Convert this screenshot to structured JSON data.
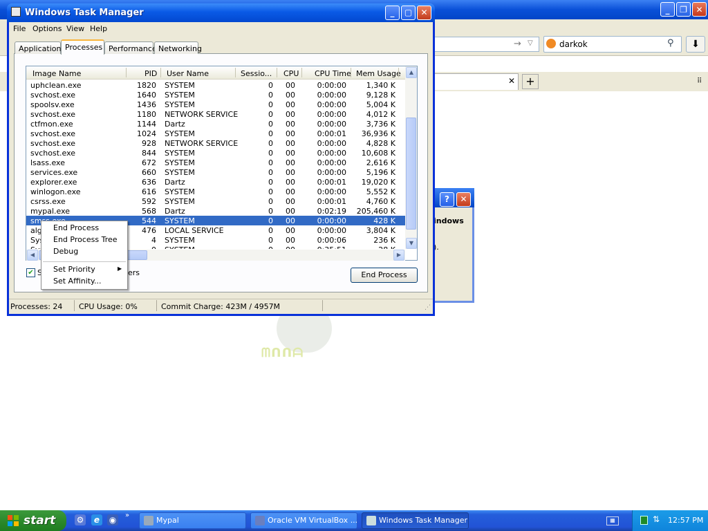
{
  "browser": {
    "search_text": "darkok",
    "dialog_text": "indows",
    "dialog_text2": ")."
  },
  "window": {
    "title": "Windows Task Manager"
  },
  "menu": [
    "File",
    "Options",
    "View",
    "Help"
  ],
  "tabs": [
    "Applications",
    "Processes",
    "Performance",
    "Networking"
  ],
  "columns": [
    "Image Name",
    "PID",
    "User Name",
    "Sessio...",
    "CPU",
    "CPU Time",
    "Mem Usage"
  ],
  "processes": [
    {
      "name": "uphclean.exe",
      "pid": "1820",
      "user": "SYSTEM",
      "session": "0",
      "cpu": "00",
      "time": "0:00:00",
      "mem": "1,340 K"
    },
    {
      "name": "svchost.exe",
      "pid": "1640",
      "user": "SYSTEM",
      "session": "0",
      "cpu": "00",
      "time": "0:00:00",
      "mem": "9,128 K"
    },
    {
      "name": "spoolsv.exe",
      "pid": "1436",
      "user": "SYSTEM",
      "session": "0",
      "cpu": "00",
      "time": "0:00:00",
      "mem": "5,004 K"
    },
    {
      "name": "svchost.exe",
      "pid": "1180",
      "user": "NETWORK SERVICE",
      "session": "0",
      "cpu": "00",
      "time": "0:00:00",
      "mem": "4,012 K"
    },
    {
      "name": "ctfmon.exe",
      "pid": "1144",
      "user": "Dartz",
      "session": "0",
      "cpu": "00",
      "time": "0:00:00",
      "mem": "3,736 K"
    },
    {
      "name": "svchost.exe",
      "pid": "1024",
      "user": "SYSTEM",
      "session": "0",
      "cpu": "00",
      "time": "0:00:01",
      "mem": "36,936 K"
    },
    {
      "name": "svchost.exe",
      "pid": "928",
      "user": "NETWORK SERVICE",
      "session": "0",
      "cpu": "00",
      "time": "0:00:00",
      "mem": "4,828 K"
    },
    {
      "name": "svchost.exe",
      "pid": "844",
      "user": "SYSTEM",
      "session": "0",
      "cpu": "00",
      "time": "0:00:00",
      "mem": "10,608 K"
    },
    {
      "name": "lsass.exe",
      "pid": "672",
      "user": "SYSTEM",
      "session": "0",
      "cpu": "00",
      "time": "0:00:00",
      "mem": "2,616 K"
    },
    {
      "name": "services.exe",
      "pid": "660",
      "user": "SYSTEM",
      "session": "0",
      "cpu": "00",
      "time": "0:00:00",
      "mem": "5,196 K"
    },
    {
      "name": "explorer.exe",
      "pid": "636",
      "user": "Dartz",
      "session": "0",
      "cpu": "00",
      "time": "0:00:01",
      "mem": "19,020 K"
    },
    {
      "name": "winlogon.exe",
      "pid": "616",
      "user": "SYSTEM",
      "session": "0",
      "cpu": "00",
      "time": "0:00:00",
      "mem": "5,552 K"
    },
    {
      "name": "csrss.exe",
      "pid": "592",
      "user": "SYSTEM",
      "session": "0",
      "cpu": "00",
      "time": "0:00:01",
      "mem": "4,760 K"
    },
    {
      "name": "mypal.exe",
      "pid": "568",
      "user": "Dartz",
      "session": "0",
      "cpu": "00",
      "time": "0:02:19",
      "mem": "205,460 K"
    },
    {
      "name": "smss.exe",
      "pid": "544",
      "user": "SYSTEM",
      "session": "0",
      "cpu": "00",
      "time": "0:00:00",
      "mem": "428 K"
    },
    {
      "name": "alg",
      "pid": "476",
      "user": "LOCAL SERVICE",
      "session": "0",
      "cpu": "00",
      "time": "0:00:00",
      "mem": "3,804 K"
    },
    {
      "name": "Sys",
      "pid": "4",
      "user": "SYSTEM",
      "session": "0",
      "cpu": "00",
      "time": "0:00:06",
      "mem": "236 K"
    },
    {
      "name": "Sys",
      "pid": "0",
      "user": "SYSTEM",
      "session": "0",
      "cpu": "00",
      "time": "0:35:51",
      "mem": "28 K"
    }
  ],
  "selected_process": "smss.exe",
  "show_all_label": "ers",
  "end_process_button": "End Process",
  "context_menu": {
    "items": [
      "End Process",
      "End Process Tree",
      "Debug",
      "Set Priority",
      "Set Affinity..."
    ]
  },
  "status": {
    "processes": "Processes: 24",
    "cpu": "CPU Usage: 0%",
    "commit": "Commit Charge: 423M / 4957M"
  },
  "taskbar": {
    "start_label": "start",
    "tasks": [
      "Mypal",
      "Oracle VM VirtualBox ...",
      "Windows Task Manager"
    ],
    "active_task": "Windows Task Manager",
    "clock": "12:57 PM",
    "colors": {
      "taskbar": "#245edb",
      "start": "#2f8c2f",
      "tray": "#0f84db"
    }
  }
}
